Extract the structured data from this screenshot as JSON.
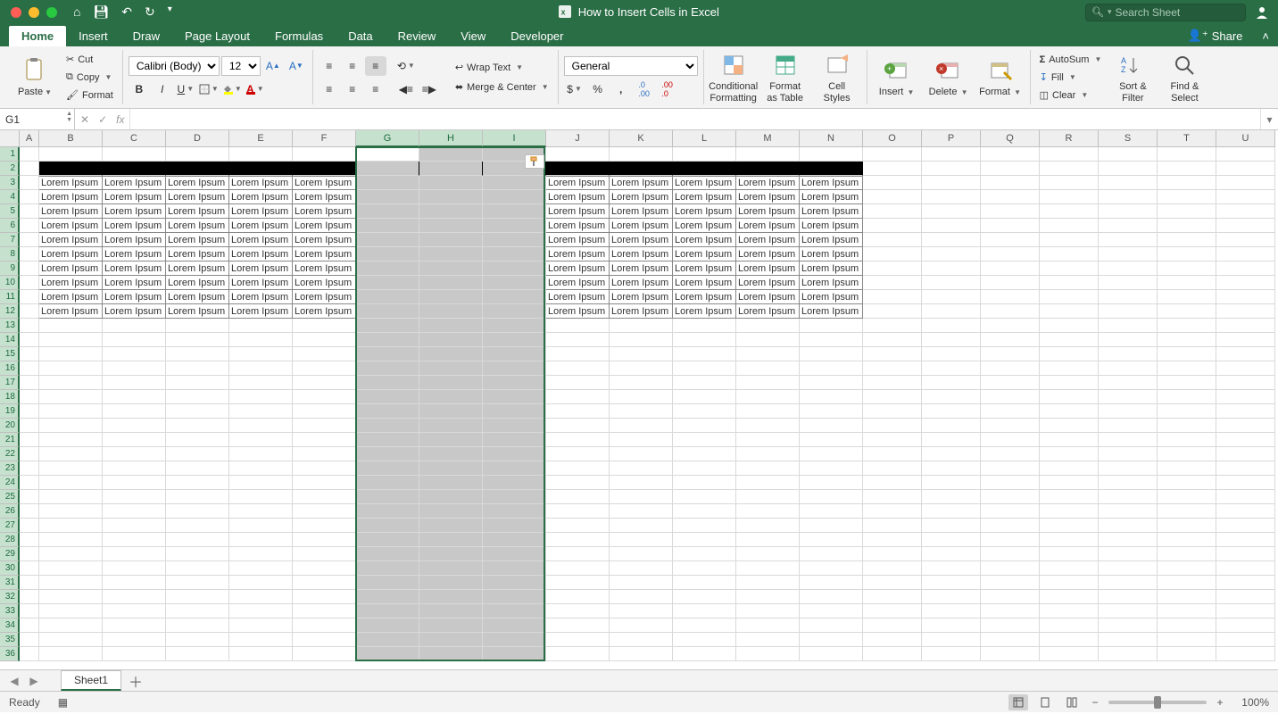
{
  "title": "How to Insert Cells in Excel",
  "search_placeholder": "Search Sheet",
  "tabs": [
    "Home",
    "Insert",
    "Draw",
    "Page Layout",
    "Formulas",
    "Data",
    "Review",
    "View",
    "Developer"
  ],
  "active_tab": "Home",
  "share_label": "Share",
  "clipboard": {
    "paste": "Paste",
    "cut": "Cut",
    "copy": "Copy",
    "format": "Format"
  },
  "font": {
    "name": "Calibri (Body)",
    "size": "12"
  },
  "alignment": {
    "wrap": "Wrap Text",
    "merge": "Merge & Center"
  },
  "number": {
    "format": "General"
  },
  "styles": {
    "conditional": "Conditional\nFormatting",
    "format_table": "Format\nas Table",
    "cell_styles": "Cell\nStyles"
  },
  "cells": {
    "insert": "Insert",
    "delete": "Delete",
    "format": "Format"
  },
  "editing": {
    "autosum": "AutoSum",
    "fill": "Fill",
    "clear": "Clear",
    "sort": "Sort &\nFilter",
    "find": "Find &\nSelect"
  },
  "name_box": "G1",
  "fx_label": "fx",
  "columns": [
    "A",
    "B",
    "C",
    "D",
    "E",
    "F",
    "G",
    "H",
    "I",
    "J",
    "K",
    "L",
    "M",
    "N",
    "O",
    "P",
    "Q",
    "R",
    "S",
    "T",
    "U"
  ],
  "col_widths": {
    "A": 22,
    "default": 71,
    "sel": 71,
    "far": 66
  },
  "rows": 36,
  "selected_cols": [
    "G",
    "H",
    "I"
  ],
  "cell_text": "Lorem Ipsum",
  "data_cols_left": [
    "B",
    "C",
    "D",
    "E",
    "F"
  ],
  "data_cols_right": [
    "J",
    "K",
    "L",
    "M",
    "N"
  ],
  "data_rows_start": 3,
  "data_rows_end": 12,
  "black_row": 2,
  "sheet_tab": "Sheet1",
  "status": "Ready",
  "zoom": "100%"
}
